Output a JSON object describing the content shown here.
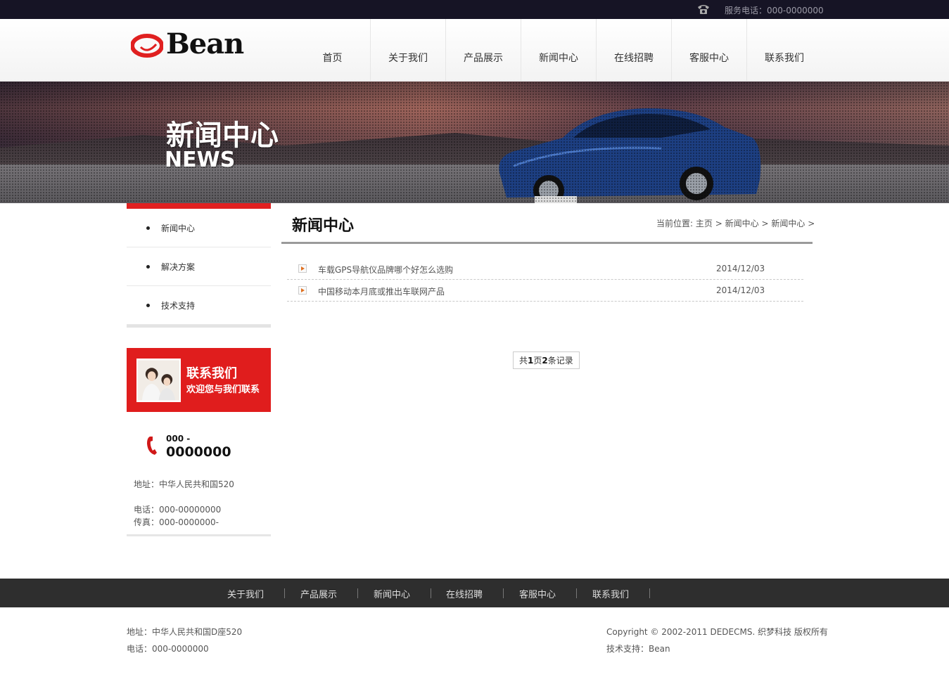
{
  "topbar": {
    "service_text": "服务电话：000-0000000",
    "icon": "telephone-icon"
  },
  "header": {
    "logo_text": "Bean"
  },
  "nav": [
    {
      "label": "首页"
    },
    {
      "label": "关于我们"
    },
    {
      "label": "产品展示"
    },
    {
      "label": "新闻中心"
    },
    {
      "label": "在线招聘"
    },
    {
      "label": "客服中心"
    },
    {
      "label": "联系我们"
    }
  ],
  "banner": {
    "title_cn": "新闻中心",
    "title_en": "NEWS"
  },
  "sidebar": {
    "items": [
      {
        "label": "新闻中心"
      },
      {
        "label": "解决方案"
      },
      {
        "label": "技术支持"
      }
    ],
    "contact_card": {
      "title": "联系我们",
      "subtitle": "欢迎您与我们联系"
    },
    "hotline": {
      "prefix": "000 -",
      "number": "0000000"
    },
    "address": "地址：中华人民共和国520",
    "phone": "电话：000-00000000",
    "fax": "传真：000-0000000-"
  },
  "main": {
    "title": "新闻中心",
    "breadcrumb": {
      "prefix": "当前位置:",
      "items": [
        "主页",
        "新闻中心",
        "新闻中心"
      ],
      "separator": ">"
    },
    "news": [
      {
        "title": "车载GPS导航仪品牌哪个好怎么选购",
        "date": "2014/12/03"
      },
      {
        "title": "中国移动本月底或推出车联网产品",
        "date": "2014/12/03"
      }
    ],
    "pager": {
      "t1": "共 ",
      "pages": "1",
      "t2": "页",
      "records": "2",
      "t3": "条记录"
    }
  },
  "footer": {
    "nav": [
      "关于我们",
      "产品展示",
      "新闻中心",
      "在线招聘",
      "客服中心",
      "联系我们"
    ],
    "address": "地址：中华人民共和国D座520",
    "phone": "电话：000-0000000",
    "copyright": "Copyright © 2002-2011 DEDECMS. 织梦科技 版权所有",
    "support": "技术支持：Bean"
  },
  "colors": {
    "accent": "#e01d1d",
    "topbar": "#161425",
    "footer": "#2e2e2e"
  }
}
